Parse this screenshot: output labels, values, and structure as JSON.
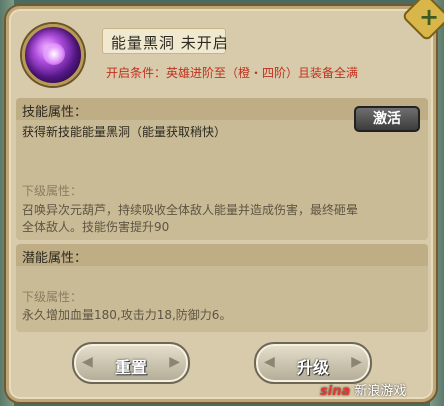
{
  "skill": {
    "name": "能量黑洞  未开启",
    "condition": "开启条件：英雄进阶至（橙・四阶）且装备全满"
  },
  "skill_attr": {
    "title": "技能属性：",
    "text": "获得新技能能量黑洞（能量获取稍快）",
    "activate_label": "激活",
    "next_level_title": "下级属性：",
    "desc_line1": "召唤异次元葫芦，持续吸收全体敌人能量并造成伤害，最终砸晕",
    "desc_line2": "全体敌人。技能伤害提升90"
  },
  "potential_attr": {
    "title": "潜能属性：",
    "next_level_title": "下级属性：",
    "desc": "永久增加血量180,攻击力18,防御力6。"
  },
  "buttons": {
    "reset": "重置",
    "upgrade": "升级"
  },
  "watermark": {
    "logo": "sina",
    "text": "新浪游戏"
  },
  "icons": [
    "energy-black-hole-orb-icon",
    "plus-icon",
    "arrow-left-icon",
    "arrow-right-icon"
  ]
}
